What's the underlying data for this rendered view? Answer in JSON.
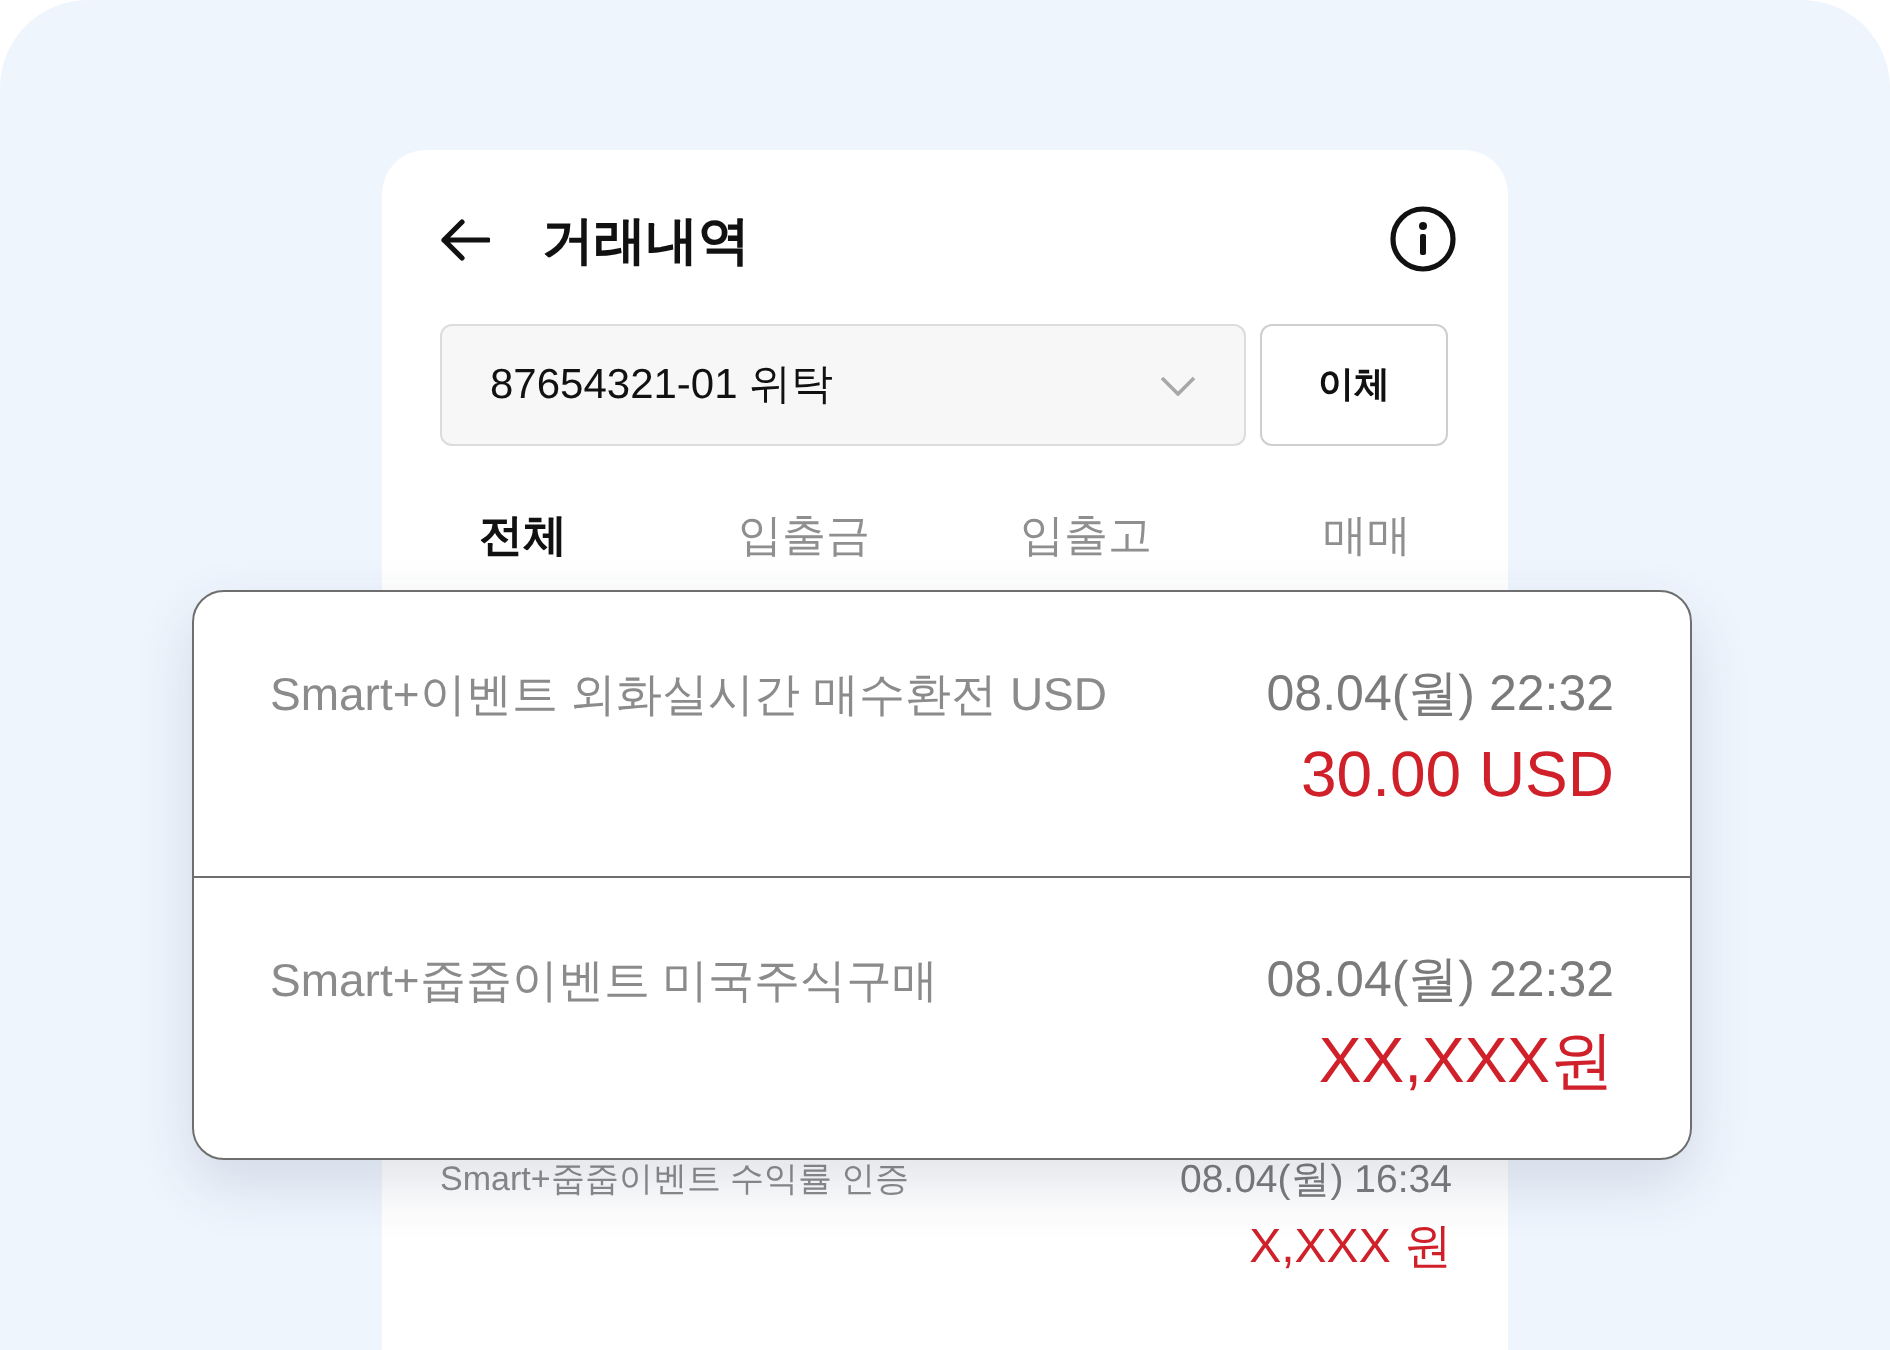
{
  "header": {
    "title": "거래내역"
  },
  "account": {
    "value": "87654321-01 위탁",
    "transfer_button": "이체"
  },
  "tabs": [
    {
      "label": "전체",
      "selected": true
    },
    {
      "label": "입출금",
      "selected": false
    },
    {
      "label": "입출고",
      "selected": false
    },
    {
      "label": "매매",
      "selected": false
    }
  ],
  "highlighted_transactions": [
    {
      "description": "Smart+이벤트 외화실시간 매수환전 USD",
      "datetime": "08.04(월) 22:32",
      "amount": "30.00 USD"
    },
    {
      "description": "Smart+줍줍이벤트 미국주식구매",
      "datetime": "08.04(월) 22:32",
      "amount": "XX,XXX원"
    }
  ],
  "transactions": [
    {
      "description": "Smart+줍줍이벤트 수익률 인증",
      "datetime": "08.04(월) 16:34",
      "amount": "X,XXX 원"
    }
  ]
}
